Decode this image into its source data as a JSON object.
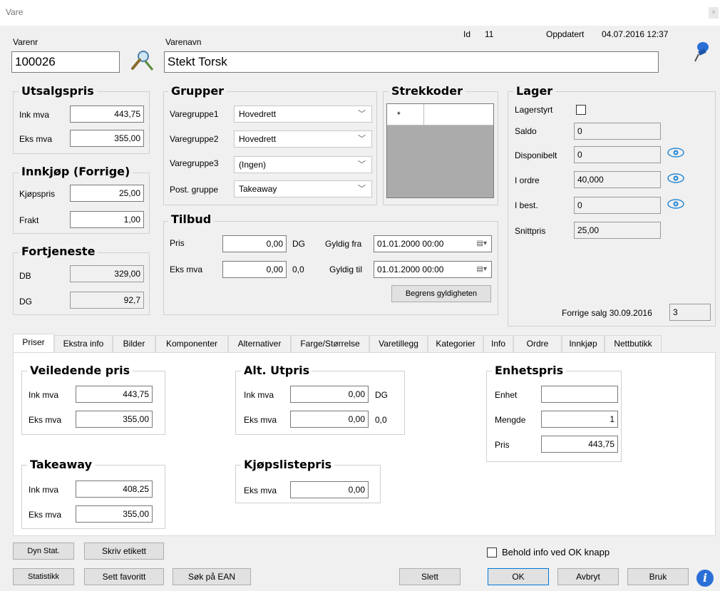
{
  "window": {
    "title": "Vare",
    "close": "×"
  },
  "header": {
    "varenr_label": "Varenr",
    "varenr_value": "100026",
    "varenavn_label": "Varenavn",
    "varenavn_value": "Stekt Torsk",
    "id_label": "Id",
    "id_value": "11",
    "updated_label": "Oppdatert",
    "updated_value": "04.07.2016 12:37"
  },
  "utsalgspris": {
    "title": "Utsalgspris",
    "ink_label": "Ink mva",
    "ink_value": "443,75",
    "eks_label": "Eks mva",
    "eks_value": "355,00"
  },
  "innkjop": {
    "title": "Innkjøp (Forrige)",
    "kjop_label": "Kjøpspris",
    "kjop_value": "25,00",
    "frakt_label": "Frakt",
    "frakt_value": "1,00"
  },
  "fortjeneste": {
    "title": "Fortjeneste",
    "db_label": "DB",
    "db_value": "329,00",
    "dg_label": "DG",
    "dg_value": "92,7"
  },
  "grupper": {
    "title": "Grupper",
    "rows": [
      {
        "label": "Varegruppe1",
        "value": "Hovedrett"
      },
      {
        "label": "Varegruppe2",
        "value": "Hovedrett"
      },
      {
        "label": "Varegruppe3",
        "value": "(Ingen)"
      },
      {
        "label": "Post. gruppe",
        "value": "Takeaway"
      }
    ]
  },
  "strekkoder": {
    "title": "Strekkoder",
    "row_marker": "*"
  },
  "tilbud": {
    "title": "Tilbud",
    "pris_label": "Pris",
    "pris_value": "0,00",
    "pris_suffix": "DG",
    "eks_label": "Eks mva",
    "eks_value": "0,00",
    "eks_suffix": "0,0",
    "fra_label": "Gyldig fra",
    "fra_value": "01.01.2000 00:00",
    "til_label": "Gyldig til",
    "til_value": "01.01.2000 00:00",
    "begrens_button": "Begrens gyldigheten"
  },
  "lager": {
    "title": "Lager",
    "lagerstyrt_label": "Lagerstyrt",
    "saldo_label": "Saldo",
    "saldo_value": "0",
    "disp_label": "Disponibelt",
    "disp_value": "0",
    "iordre_label": "I ordre",
    "iordre_value": "40,000",
    "ibest_label": "I best.",
    "ibest_value": "0",
    "snitt_label": "Snittpris",
    "snitt_value": "25,00",
    "forrige_label": "Forrige salg 30.09.2016",
    "forrige_value": "3"
  },
  "tabs": [
    "Priser",
    "Ekstra info",
    "Bilder",
    "Komponenter",
    "Alternativer",
    "Farge/Størrelse",
    "Varetillegg",
    "Kategorier",
    "Info",
    "Ordre",
    "Innkjøp",
    "Nettbutikk"
  ],
  "priser": {
    "veil": {
      "title": "Veiledende pris",
      "ink_label": "Ink mva",
      "ink_value": "443,75",
      "eks_label": "Eks mva",
      "eks_value": "355,00"
    },
    "alt": {
      "title": "Alt. Utpris",
      "ink_label": "Ink mva",
      "ink_value": "0,00",
      "ink_suffix": "DG",
      "eks_label": "Eks mva",
      "eks_value": "0,00",
      "eks_suffix": "0,0"
    },
    "enhet": {
      "title": "Enhetspris",
      "enhet_label": "Enhet",
      "enhet_value": "",
      "mengde_label": "Mengde",
      "mengde_value": "1",
      "pris_label": "Pris",
      "pris_value": "443,75"
    },
    "takeaway": {
      "title": "Takeaway",
      "ink_label": "Ink mva",
      "ink_value": "408,25",
      "eks_label": "Eks mva",
      "eks_value": "355,00"
    },
    "kjopsliste": {
      "title": "Kjøpslistepris",
      "eks_label": "Eks mva",
      "eks_value": "0,00"
    }
  },
  "footer": {
    "dyn_stat": "Dyn Stat.",
    "skriv_etikett": "Skriv etikett",
    "statistikk": "Statistikk",
    "sett_favoritt": "Sett favoritt",
    "sok_ean": "Søk på EAN",
    "slett": "Slett",
    "ok": "OK",
    "avbryt": "Avbryt",
    "bruk": "Bruk",
    "behold_label": "Behold info ved OK knapp",
    "info_icon": "i"
  },
  "colors": {
    "accent_blue": "#2a6fd6",
    "eye_blue": "#2a8ad4"
  }
}
